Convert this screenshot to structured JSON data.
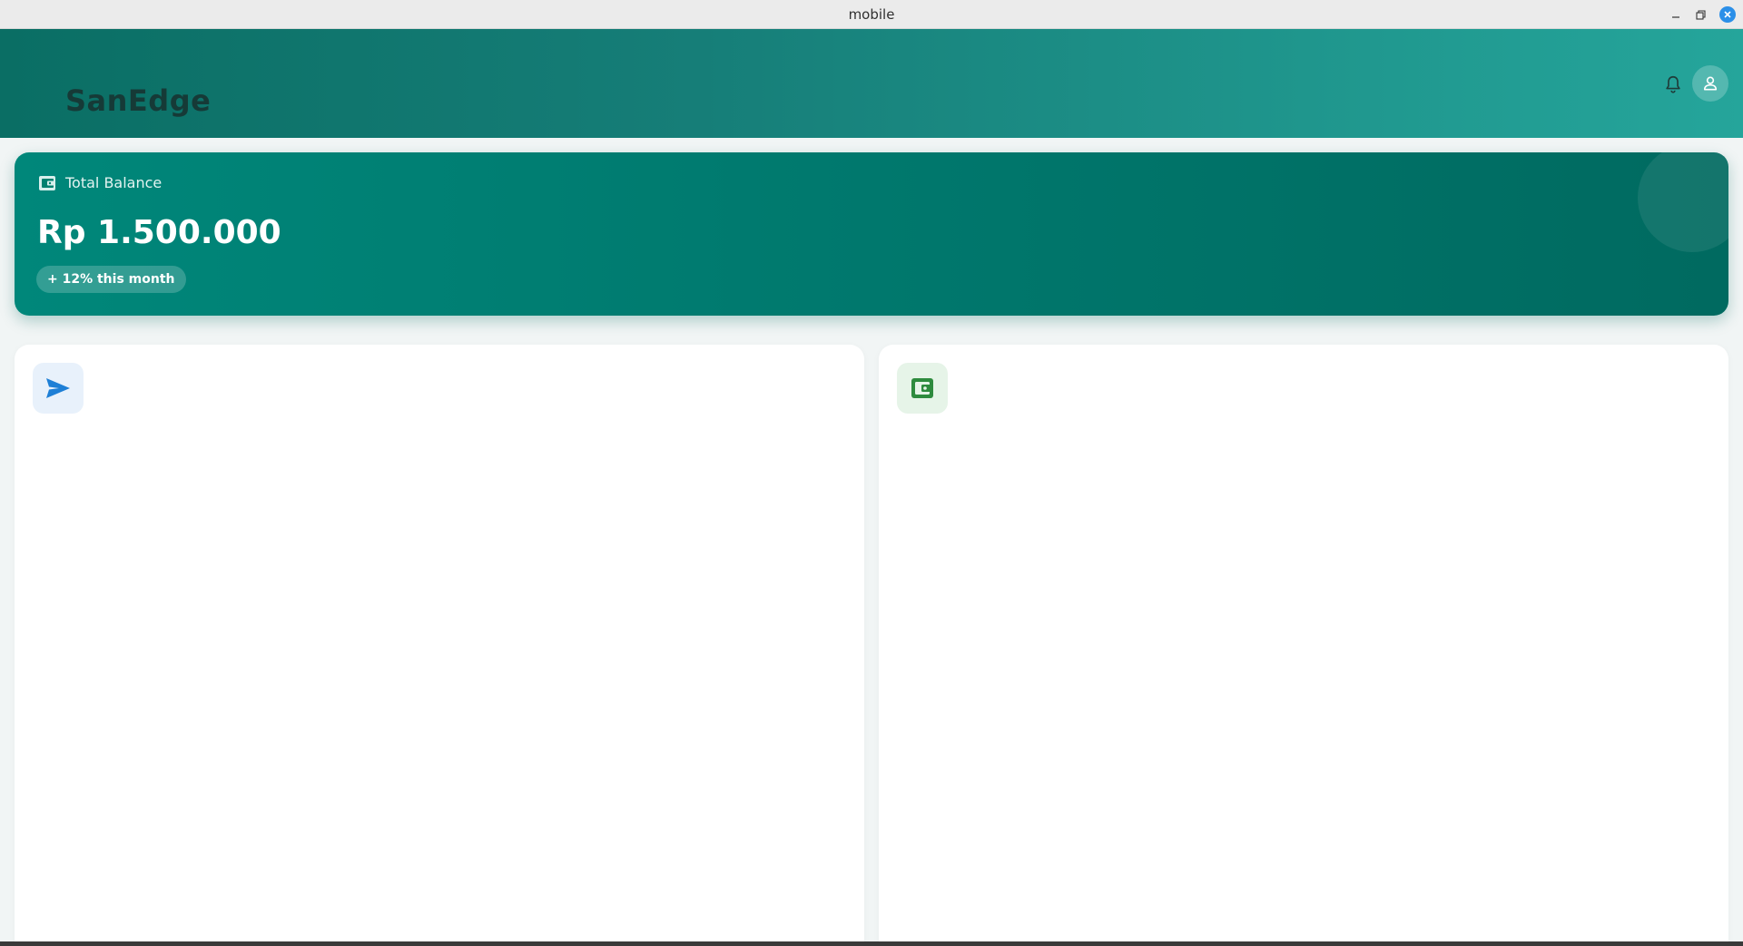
{
  "window": {
    "title": "mobile"
  },
  "header": {
    "app_title": "SanEdge",
    "notification_icon": "bell-icon",
    "profile_icon": "user-icon"
  },
  "balance": {
    "icon": "wallet-icon",
    "label": "Total Balance",
    "amount": "Rp 1.500.000",
    "growth": "+ 12% this month"
  },
  "actions": [
    {
      "icon": "send-icon",
      "icon_color": "#1e7fd6"
    },
    {
      "icon": "wallet-icon",
      "icon_color": "#2e8b3e"
    }
  ],
  "colors": {
    "header_gradient_start": "#0a6e64",
    "header_gradient_end": "#25a59b",
    "card_start": "#00877a",
    "card_end": "#006a60",
    "title_text": "#163a37"
  }
}
